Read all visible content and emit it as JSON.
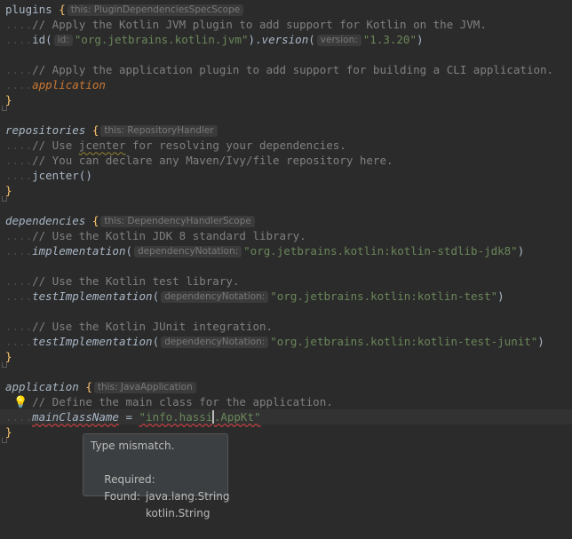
{
  "code": [
    {
      "tokens": [
        {
          "k": "pl",
          "t": "plugins "
        },
        {
          "k": "fn",
          "t": "{"
        },
        {
          "k": "hint",
          "t": "this: PluginDependenciesSpecScope"
        }
      ]
    },
    {
      "tokens": [
        {
          "k": "dots",
          "t": "...."
        },
        {
          "k": "cm",
          "t": "// Apply the Kotlin JVM plugin to add support for Kotlin on the JVM."
        }
      ]
    },
    {
      "tokens": [
        {
          "k": "dots",
          "t": "...."
        },
        {
          "k": "pl",
          "t": "id("
        },
        {
          "k": "hint",
          "t": "id:"
        },
        {
          "k": "str",
          "t": "\"org.jetbrains.kotlin.jvm\""
        },
        {
          "k": "pl",
          "t": ")."
        },
        {
          "k": "it",
          "t": "version"
        },
        {
          "k": "pl",
          "t": "("
        },
        {
          "k": "hint",
          "t": "version:"
        },
        {
          "k": "str",
          "t": "\"1.3.20\""
        },
        {
          "k": "pl",
          "t": ")"
        }
      ]
    },
    {
      "tokens": []
    },
    {
      "tokens": [
        {
          "k": "dots",
          "t": "...."
        },
        {
          "k": "cm",
          "t": "// Apply the application plugin to add support for building a CLI application."
        }
      ]
    },
    {
      "tokens": [
        {
          "k": "dots",
          "t": "...."
        },
        {
          "k": "kwit",
          "t": "application"
        }
      ]
    },
    {
      "tokens": [
        {
          "k": "fn",
          "t": "}"
        }
      ]
    },
    {
      "tokens": []
    },
    {
      "tokens": [
        {
          "k": "it",
          "t": "repositories"
        },
        {
          "k": "pl",
          "t": " "
        },
        {
          "k": "fn",
          "t": "{"
        },
        {
          "k": "hint",
          "t": "this: RepositoryHandler"
        }
      ]
    },
    {
      "tokens": [
        {
          "k": "dots",
          "t": "...."
        },
        {
          "k": "cm",
          "t": "// Use "
        },
        {
          "k": "cmlint",
          "t": "jcenter"
        },
        {
          "k": "cm",
          "t": " for resolving your dependencies."
        }
      ]
    },
    {
      "tokens": [
        {
          "k": "dots",
          "t": "...."
        },
        {
          "k": "cm",
          "t": "// You can declare any Maven/Ivy/file repository here."
        }
      ]
    },
    {
      "tokens": [
        {
          "k": "dots",
          "t": "...."
        },
        {
          "k": "pl",
          "t": "jcenter()"
        }
      ]
    },
    {
      "tokens": [
        {
          "k": "fn",
          "t": "}"
        }
      ]
    },
    {
      "tokens": []
    },
    {
      "tokens": [
        {
          "k": "it",
          "t": "dependencies"
        },
        {
          "k": "pl",
          "t": " "
        },
        {
          "k": "fn",
          "t": "{"
        },
        {
          "k": "hint",
          "t": "this: DependencyHandlerScope"
        }
      ]
    },
    {
      "tokens": [
        {
          "k": "dots",
          "t": "...."
        },
        {
          "k": "cm",
          "t": "// Use the Kotlin JDK 8 standard library."
        }
      ]
    },
    {
      "tokens": [
        {
          "k": "dots",
          "t": "...."
        },
        {
          "k": "it",
          "t": "implementation"
        },
        {
          "k": "pl",
          "t": "("
        },
        {
          "k": "hint",
          "t": "dependencyNotation:"
        },
        {
          "k": "str",
          "t": "\"org.jetbrains.kotlin:kotlin-stdlib-jdk8\""
        },
        {
          "k": "pl",
          "t": ")"
        }
      ]
    },
    {
      "tokens": []
    },
    {
      "tokens": [
        {
          "k": "dots",
          "t": "...."
        },
        {
          "k": "cm",
          "t": "// Use the Kotlin test library."
        }
      ]
    },
    {
      "tokens": [
        {
          "k": "dots",
          "t": "...."
        },
        {
          "k": "it",
          "t": "testImplementation"
        },
        {
          "k": "pl",
          "t": "("
        },
        {
          "k": "hint",
          "t": "dependencyNotation:"
        },
        {
          "k": "str",
          "t": "\"org.jetbrains.kotlin:kotlin-test\""
        },
        {
          "k": "pl",
          "t": ")"
        }
      ]
    },
    {
      "tokens": []
    },
    {
      "tokens": [
        {
          "k": "dots",
          "t": "...."
        },
        {
          "k": "cm",
          "t": "// Use the Kotlin JUnit integration."
        }
      ]
    },
    {
      "tokens": [
        {
          "k": "dots",
          "t": "...."
        },
        {
          "k": "it",
          "t": "testImplementation"
        },
        {
          "k": "pl",
          "t": "("
        },
        {
          "k": "hint",
          "t": "dependencyNotation:"
        },
        {
          "k": "str",
          "t": "\"org.jetbrains.kotlin:kotlin-test-junit\""
        },
        {
          "k": "pl",
          "t": ")"
        }
      ]
    },
    {
      "tokens": [
        {
          "k": "fn",
          "t": "}"
        }
      ]
    },
    {
      "tokens": []
    },
    {
      "tokens": [
        {
          "k": "it",
          "t": "application"
        },
        {
          "k": "pl",
          "t": " "
        },
        {
          "k": "fn",
          "t": "{"
        },
        {
          "k": "hint",
          "t": "this: JavaApplication"
        }
      ]
    },
    {
      "tokens": [
        {
          "k": "dots",
          "t": "    "
        },
        {
          "k": "cm",
          "t": "// Define the main class for the application."
        }
      ]
    },
    {
      "current": true,
      "tokens": [
        {
          "k": "dots",
          "t": "...."
        },
        {
          "k": "err",
          "t": "mainClassName"
        },
        {
          "k": "pl",
          "t": " = "
        },
        {
          "k": "strerr",
          "t": "\"info.hassi"
        },
        {
          "k": "caret",
          "t": ""
        },
        {
          "k": "strerr",
          "t": ".AppKt\""
        }
      ]
    },
    {
      "tokens": [
        {
          "k": "fn",
          "t": "}"
        }
      ]
    }
  ],
  "intention_bulb": "lightbulb-icon",
  "tooltip": {
    "title": "Type mismatch.",
    "required_label": "Required:",
    "required_value": "java.lang.String",
    "found_label": "Found:",
    "found_value": "kotlin.String"
  },
  "colors": {
    "background": "#2b2b2b",
    "keyword": "#cc7832",
    "comment": "#808080",
    "string": "#6a8759",
    "text": "#a9b7c6",
    "error_underline": "#bc3f3c",
    "bulb": "#f5c518"
  }
}
